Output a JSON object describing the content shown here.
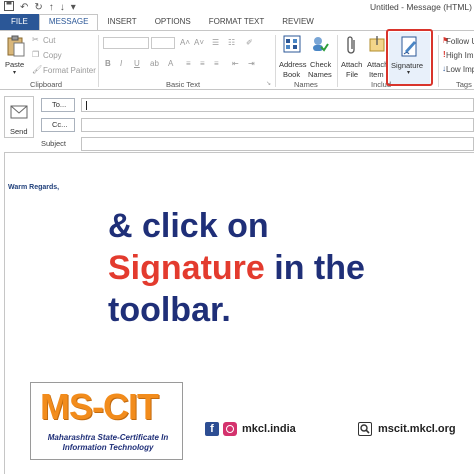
{
  "window": {
    "title": "Untitled - Message (HTML)"
  },
  "quick_access": [
    "save-icon",
    "undo-icon",
    "redo-icon",
    "up-arrow-icon",
    "down-arrow-icon",
    "customize-icon"
  ],
  "tabs": [
    {
      "label": "FILE"
    },
    {
      "label": "MESSAGE"
    },
    {
      "label": "INSERT"
    },
    {
      "label": "OPTIONS"
    },
    {
      "label": "FORMAT TEXT"
    },
    {
      "label": "REVIEW"
    }
  ],
  "ribbon": {
    "clipboard": {
      "paste": "Paste",
      "cut": "Cut",
      "copy": "Copy",
      "format_painter": "Format Painter",
      "group": "Clipboard"
    },
    "basic_text": {
      "bold": "B",
      "italic": "I",
      "underline": "U",
      "group": "Basic Text"
    },
    "names": {
      "address_book_1": "Address",
      "address_book_2": "Book",
      "check_names_1": "Check",
      "check_names_2": "Names",
      "group": "Names"
    },
    "include": {
      "attach_file_1": "Attach",
      "attach_file_2": "File",
      "attach_item_1": "Attach",
      "attach_item_2": "Item",
      "signature": "Signature",
      "group": "Includ"
    },
    "tags": {
      "follow_up": "Follow U",
      "high_importance": "High Imp",
      "low_importance": "Low Imp",
      "group": "Tags"
    }
  },
  "compose": {
    "send": "Send",
    "to": "To...",
    "cc": "Cc...",
    "subject": "Subject",
    "body_text": "Warm Regards,"
  },
  "overlay": {
    "line1": "& click on",
    "line2_red": "Signature",
    "line2_rest": " in the",
    "line3": "toolbar."
  },
  "branding": {
    "logo": "MS-CIT",
    "sub1": "Maharashtra State-Certificate In",
    "sub2": "Information Technology",
    "social_handle": "mkcl.india",
    "website": "mscit.mkcl.org"
  },
  "colors": {
    "file_tab": "#2b5797",
    "highlight": "#d9342b",
    "overlay_blue": "#1f2f78",
    "overlay_red": "#e33b2e",
    "logo_orange": "#f28c1c"
  }
}
